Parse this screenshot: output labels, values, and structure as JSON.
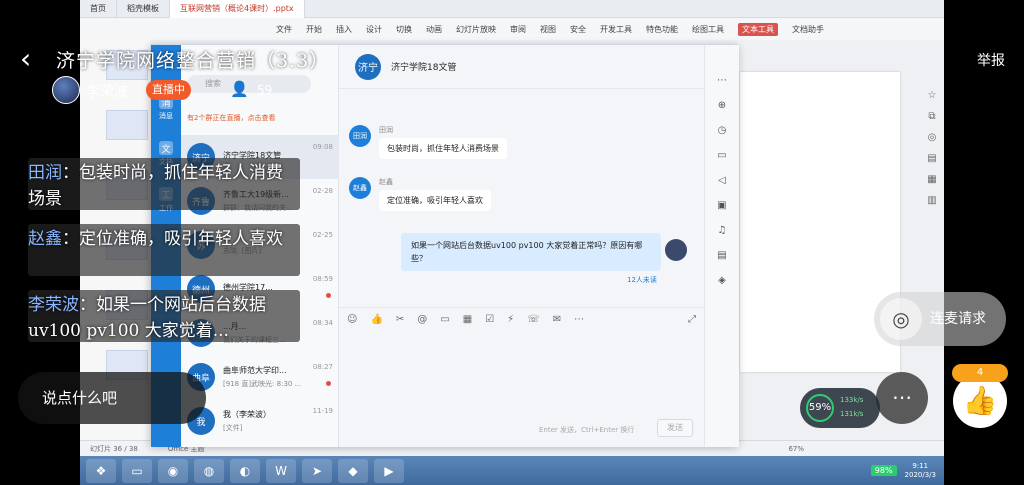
{
  "desktop": {
    "tabs": [
      "首页",
      "稻壳模板",
      "互联网营销（概论4课时）.pptx"
    ],
    "menu": [
      "文件",
      "开始",
      "插入",
      "设计",
      "切换",
      "动画",
      "幻灯片放映",
      "审阅",
      "视图",
      "安全",
      "开发工具",
      "特色功能",
      "绘图工具",
      "文本工具",
      "文档助手"
    ],
    "menu_highlight": "文本工具",
    "status_slide": "幻灯片 36 / 38",
    "status_theme": "Office 主题",
    "status_zoom": "67%",
    "taskbar_time": "9:11",
    "taskbar_date": "2020/3/3",
    "battery": "98%"
  },
  "chat": {
    "nav": [
      {
        "icon": "消",
        "label": "消息"
      },
      {
        "icon": "文",
        "label": "文档"
      },
      {
        "icon": "工",
        "label": "工作"
      }
    ],
    "search_placeholder": "搜索",
    "group_banner": "有2个群正在直播，点击查看",
    "contacts": [
      {
        "avatar": "济宁",
        "name": "济宁学院18文管",
        "msg": "",
        "time": "09:08",
        "dot": false
      },
      {
        "avatar": "齐鲁",
        "name": "齐鲁工大19级新...",
        "msg": "群群：我请问我的关...",
        "time": "02-28",
        "dot": false
      },
      {
        "avatar": "苏",
        "name": "...",
        "msg": "苏晓: [图片]",
        "time": "02-25",
        "dot": false
      },
      {
        "avatar": "德州",
        "name": "德州学院17...",
        "msg": "",
        "time": "08:59",
        "dot": true
      },
      {
        "avatar": "李",
        "name": "...月...",
        "msg": "我们关于的课程三...",
        "time": "08:34",
        "dot": false
      },
      {
        "avatar": "曲阜",
        "name": "曲阜师范大学印...",
        "msg": "[918 直]武映光: 8:30 ...",
        "time": "08:27",
        "dot": true
      },
      {
        "avatar": "我",
        "name": "我（李荣波）",
        "msg": "[文件]",
        "time": "11-19",
        "dot": false
      }
    ],
    "conversation": {
      "avatar": "济宁",
      "title": "济宁学院18文管",
      "messages": [
        {
          "avatar": "田润",
          "name": "田润",
          "text": "包装时尚，抓住年轻人消费场景"
        },
        {
          "avatar": "赵鑫",
          "name": "赵鑫",
          "text": "定位准确，吸引年轻人喜欢"
        }
      ],
      "my_message": "如果一个网站后台数据uv100  pv100  大家觉着正常吗？原因有哪些？",
      "read_status": "12人未读",
      "input_hint": "Enter 发送，Ctrl+Enter 换行",
      "send_label": "发送"
    }
  },
  "live": {
    "title": "济宁学院网络整合营销（3.3）",
    "host_name": "李荣波",
    "live_badge": "直播中",
    "viewer_count": "59",
    "report_label": "举报",
    "danmaku": [
      {
        "who": "田润",
        "text": "：包装时尚，抓住年轻人消费场景"
      },
      {
        "who": "赵鑫",
        "text": "：定位准确，吸引年轻人喜欢"
      },
      {
        "who": "李荣波",
        "text": "：如果一个网站后台数据uv100  pv100  大家觉着..."
      }
    ],
    "comment_placeholder": "说点什么吧",
    "mic_request": "连麦请求",
    "like_count": "4",
    "speed_percent": "59%",
    "net_up": "133k/s",
    "net_down": "131k/s"
  }
}
